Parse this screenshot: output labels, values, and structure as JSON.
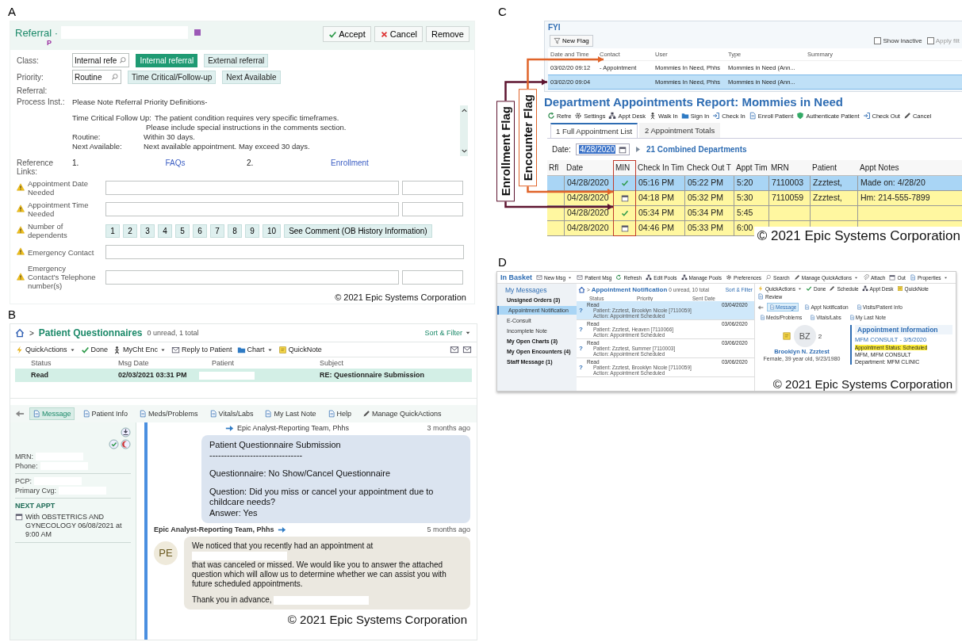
{
  "panel_a": {
    "letter": "A",
    "header": {
      "title": "Referral ·",
      "flag": "P",
      "buttons": [
        {
          "text": "Accept"
        },
        {
          "text": "Cancel"
        },
        {
          "text": "Remove"
        }
      ]
    },
    "choice_rows": [
      {
        "label": "Class:",
        "value": "Internal refe",
        "options": [
          {
            "text": "Internal referral",
            "selected": true
          },
          {
            "text": "External referral",
            "selected": false
          }
        ]
      },
      {
        "label": "Priority:",
        "value": "Routine",
        "options": [
          {
            "text": "Time Critical/Follow-up",
            "selected": false
          },
          {
            "text": "Next Available",
            "selected": false
          }
        ]
      }
    ],
    "referral_label": "Referral:",
    "process": {
      "label": "Process Inst.:",
      "lines": [
        {
          "kind": "heading",
          "text": "Please Note Referral Priority Definitions-"
        },
        {
          "kind": "inline",
          "term": "Time Critical Follow Up:",
          "text": "The patient condition requires very specific timeframes."
        },
        {
          "kind": "indent",
          "text": "Please include special instructions in the comments section."
        },
        {
          "kind": "tab",
          "term": "Routine:",
          "text": "Within 30 days."
        },
        {
          "kind": "tab",
          "term": "Next Available:",
          "text": "Next available appointment. May exceed 30 days."
        }
      ]
    },
    "reference": {
      "label": "Reference Links:",
      "links": [
        {
          "num": "1.",
          "text": "FAQs"
        },
        {
          "num": "2.",
          "text": "Enrollment"
        }
      ]
    },
    "fields": [
      {
        "label": "Appointment Date Needed",
        "warning": true,
        "kind": "double"
      },
      {
        "label": "Appointment Time Needed",
        "warning": true,
        "kind": "double"
      },
      {
        "label": "Number of dependents",
        "warning": true,
        "kind": "choices",
        "options": [
          "1",
          "2",
          "3",
          "4",
          "5",
          "6",
          "7",
          "8",
          "9",
          "10",
          "See Comment (OB History Information)"
        ]
      },
      {
        "label": "Emergency Contact",
        "warning": true,
        "kind": "single"
      },
      {
        "label": "Emergency Contact's Telephone number(s)",
        "warning": true,
        "kind": "double"
      }
    ],
    "copyright": "© 2021 Epic Systems Corporation"
  },
  "panel_b": {
    "letter": "B",
    "header": {
      "separator": ">",
      "title": "Patient Questionnaires",
      "count": "0 unread, 1 total",
      "sort": "Sort & Filter"
    },
    "toolbar": [
      {
        "text": "QuickActions",
        "dropdown": true
      },
      {
        "text": "Done",
        "dropdown": false
      },
      {
        "text": "MyCht Enc",
        "dropdown": true
      },
      {
        "text": "Reply to Patient",
        "dropdown": false
      },
      {
        "text": "Chart",
        "dropdown": true
      },
      {
        "text": "QuickNote",
        "dropdown": false
      }
    ],
    "columns": [
      "Status",
      "Msg Date",
      "Patient",
      "Subject"
    ],
    "rows": [
      {
        "status": "Read",
        "msg_date": "02/03/2021 03:31 PM",
        "subject": "RE: Questionnaire Submission",
        "selected": true
      }
    ],
    "tabs": [
      {
        "text": "Message",
        "selected": true
      },
      {
        "text": "Patient Info",
        "selected": false
      },
      {
        "text": "Meds/Problems",
        "selected": false
      },
      {
        "text": "Vitals/Labs",
        "selected": false
      },
      {
        "text": "My Last Note",
        "selected": false
      },
      {
        "text": "Help",
        "selected": false
      }
    ],
    "manage": "Manage QuickActions",
    "sidebar": {
      "groups": [
        [
          {
            "label": "MRN:"
          },
          {
            "label": "Phone:"
          }
        ],
        [
          {
            "label": "PCP:"
          },
          {
            "label": "Primary Cvg:"
          }
        ]
      ],
      "next_heading": "NEXT APPT",
      "next_text": "With OBSTETRICS AND GYNECOLOGY 06/08/2021 at 9:00 AM"
    },
    "messages": [
      {
        "sender": "Epic Analyst-Reporting Team, Phhs",
        "time": "3 months ago",
        "outgoing": true,
        "paragraphs": [
          [
            {
              "kind": "text",
              "text": "Patient Questionnaire Submission\n--------------------------------"
            }
          ],
          [
            {
              "kind": "text",
              "text": "Questionnaire: No Show/Cancel Questionnaire"
            }
          ],
          [
            {
              "kind": "text",
              "text": "Question: Did you miss or cancel your appointment due to childcare needs?\nAnswer:   Yes"
            }
          ]
        ]
      },
      {
        "sender": "Epic Analyst-Reporting Team, Phhs",
        "time": "5 months ago",
        "outgoing": false,
        "avatar": "PE",
        "paragraphs": [
          [
            {
              "kind": "text",
              "text": "We noticed that you recently had an appointment at"
            },
            {
              "kind": "redaction"
            },
            {
              "kind": "text",
              "text": "that was canceled or missed.  We would like you to answer the attached question which will allow us to determine whether we can assist you with future scheduled appointments."
            }
          ],
          [
            {
              "kind": "text",
              "text": "Thank you in advance,"
            },
            {
              "kind": "redaction"
            }
          ]
        ]
      }
    ],
    "copyright": "© 2021 Epic Systems Corporation"
  },
  "panel_c": {
    "letter": "C",
    "fyi": {
      "title": "FYI",
      "new_flag": "New Flag",
      "checkboxes": [
        {
          "text": "Show inactive",
          "checked": false
        },
        {
          "text": "Apply filt",
          "checked": false
        }
      ],
      "columns": [
        "Date and Time",
        "Contact",
        "User",
        "Type",
        "Summary"
      ],
      "rows": [
        {
          "date": "03/02/20 09:12",
          "contact": "- Appointment",
          "user": "Mommies In Need, Phhs",
          "type": "Mommies in Need (Ann...",
          "selected": false
        },
        {
          "date": "03/02/20 09:04",
          "user": "Mommies In Need, Phhs",
          "type": "Mommies in Need (Ann...",
          "selected": true
        }
      ]
    },
    "report_title": "Department Appointments Report: Mommies in Need",
    "toolbar": [
      "Refre",
      "Settings",
      "Appt Desk",
      "Walk In",
      "Sign In",
      "Check In",
      "Enroll Patient",
      "Authenticate Patient",
      "Check Out",
      "Cancel"
    ],
    "tabs": [
      {
        "text": "1 Full Appointment List",
        "selected": true
      },
      {
        "text": "2 Appointment Totals",
        "selected": false
      }
    ],
    "date_label": "Date:",
    "date_value": "4/28/2020",
    "departments": "21 Combined Departments",
    "columns": [
      "Rfl",
      "Date",
      "MIN",
      "Check In Tim",
      "Check Out T",
      "Appt Tim",
      "MRN",
      "Patient",
      "Appt Notes"
    ],
    "rows": [
      {
        "date": "04/28/2020",
        "min_check": true,
        "check_in": "05:16 PM",
        "check_out": "05:22 PM",
        "appt_time": "5:20",
        "mrn": "7110003",
        "patient": "Zzztest,",
        "notes": "Made on: 4/28/20",
        "selected": true
      },
      {
        "date": "04/28/2020",
        "min_check": false,
        "check_in": "04:18 PM",
        "check_out": "05:32 PM",
        "appt_time": "5:30",
        "mrn": "7110059",
        "patient": "Zzztest,",
        "notes": "Hm: 214-555-7899",
        "selected": false
      },
      {
        "date": "04/28/2020",
        "min_check": true,
        "check_in": "05:34 PM",
        "check_out": "05:34 PM",
        "appt_time": "5:45",
        "selected": false
      },
      {
        "date": "04/28/2020",
        "min_check": false,
        "check_in": "04:46 PM",
        "check_out": "05:33 PM",
        "appt_time": "6:00",
        "selected": false
      }
    ],
    "annotations": [
      {
        "text": "Enrollment Flag",
        "color": "#5e1530"
      },
      {
        "text": "Encounter Flag",
        "color": "#e0642a"
      }
    ],
    "copyright": "© 2021 Epic Systems Corporation"
  },
  "panel_d": {
    "letter": "D",
    "title": "In Basket",
    "toolbar": [
      {
        "text": "New Msg",
        "dropdown": true
      },
      {
        "text": "Patient Msg",
        "dropdown": false
      },
      {
        "text": "Refresh",
        "dropdown": false
      },
      {
        "text": "Edit Pools",
        "dropdown": false
      },
      {
        "text": "Manage Pools",
        "dropdown": false
      },
      {
        "text": "Preferences",
        "dropdown": false
      },
      {
        "text": "Search",
        "dropdown": false
      },
      {
        "text": "Manage QuickActions",
        "dropdown": true
      },
      {
        "text": "Attach",
        "dropdown": false
      },
      {
        "text": "Out",
        "dropdown": false
      },
      {
        "text": "Properties",
        "dropdown": true
      }
    ],
    "sidebar_title": "My Messages",
    "folders": [
      {
        "text": "Unsigned Orders (3)",
        "unread": true,
        "selected": false
      },
      {
        "text": "Appointment Notification",
        "unread": false,
        "selected": true
      },
      {
        "text": "E-Consult",
        "unread": false,
        "selected": false
      },
      {
        "text": "Incomplete Note",
        "unread": false,
        "selected": false
      },
      {
        "text": "My Open Charts (3)",
        "unread": true,
        "selected": false
      },
      {
        "text": "My Open Encounters (4)",
        "unread": true,
        "selected": false
      },
      {
        "text": "Staff Message (1)",
        "unread": true,
        "selected": false
      }
    ],
    "list": {
      "separator": ">",
      "title": "Appointment Notification",
      "count": "0 unread, 10 total",
      "sort": "Sort & Filter",
      "columns": [
        "Status",
        "Priority",
        "Sent Date"
      ],
      "rows": [
        {
          "status": "Read",
          "priority": "?",
          "patient": "Patient: Zzztest, Brooklyn Nicole [7110059]",
          "action": "Action: Appointment Scheduled",
          "date": "03/04/2020",
          "selected": true
        },
        {
          "status": "Read",
          "priority": "?",
          "patient": "Patient: Zzztest, Heaven [7110066]",
          "action": "Action: Appointment Scheduled",
          "date": "03/06/2020",
          "selected": false
        },
        {
          "status": "Read",
          "priority": "?",
          "patient": "Patient: Zzztest, Summer [7110003]",
          "action": "Action: Appointment Scheduled",
          "date": "03/06/2020",
          "selected": false
        },
        {
          "status": "Read",
          "priority": "?",
          "patient": "Patient: Zzztest, Brooklyn Nicole [7110059]",
          "action": "Action: Appointment Scheduled",
          "date": "03/06/2020",
          "selected": false
        }
      ]
    },
    "detail": {
      "toolbar": [
        {
          "text": "QuickActions",
          "dropdown": true
        },
        {
          "text": "Done",
          "dropdown": false
        },
        {
          "text": "Schedule",
          "dropdown": false
        },
        {
          "text": "Appt Desk",
          "dropdown": false
        },
        {
          "text": "QuickNote",
          "dropdown": false
        },
        {
          "text": "Review",
          "dropdown": false
        }
      ],
      "tabs": [
        {
          "text": "Message",
          "selected": true
        },
        {
          "text": "Appt Notification",
          "selected": false
        },
        {
          "text": "Visits/Patient Info",
          "selected": false
        },
        {
          "text": "Meds/Problems",
          "selected": false
        },
        {
          "text": "Vitals/Labs",
          "selected": false
        },
        {
          "text": "My Last Note",
          "selected": false
        }
      ],
      "avatar": "BZ",
      "badge": "2",
      "name": "Brooklyn N. Zzztest",
      "info": "Female, 39 year old, 9/23/1980",
      "section": "Appointment Information",
      "appt": "MFM CONSULT - 3/5/2020",
      "status": "Appointment Status: Scheduled",
      "provider": "MFM, MFM CONSULT",
      "department": "Department: MFM CLINIC"
    },
    "copyright": "© 2021 Epic Systems Corporation"
  }
}
